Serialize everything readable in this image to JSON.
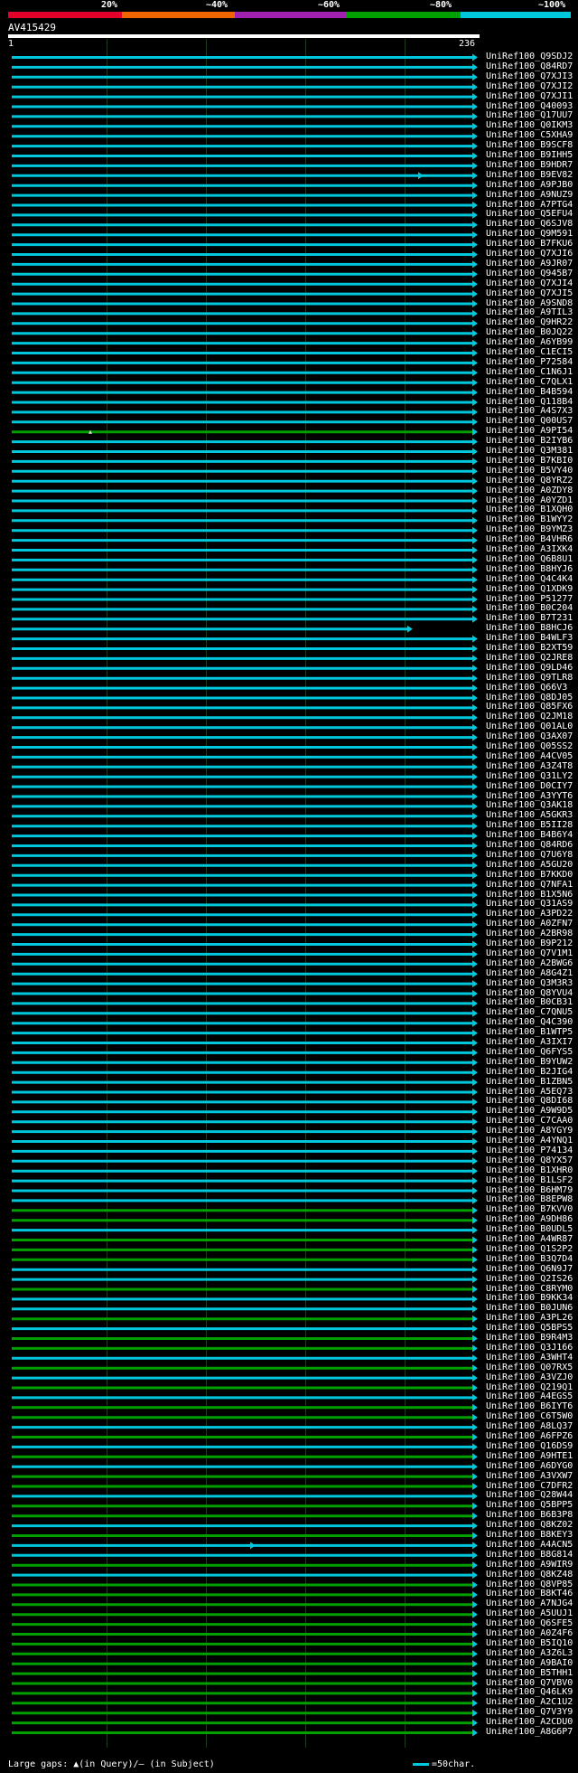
{
  "header": {
    "percent_labels": [
      "20%",
      "~40%",
      "~60%",
      "~80%",
      "~100%"
    ],
    "band_colors": [
      "#e0002a",
      "#f06400",
      "#a020b0",
      "#00a000",
      "#00c8dc"
    ],
    "query_id": "AV415429",
    "start": "1",
    "end": "236"
  },
  "colors": {
    "cyan": "#00c8dc",
    "green": "#00a000",
    "marker": "#dddddd",
    "gap": "#222222"
  },
  "hits": [
    "UniRef100_Q9SDJ2",
    "UniRef100_Q84RD7",
    "UniRef100_Q7XJI3",
    "UniRef100_Q7XJI2",
    "UniRef100_Q7XJI1",
    "UniRef100_Q40093",
    "UniRef100_Q17UU7",
    "UniRef100_Q0IKM3",
    "UniRef100_C5XHA9",
    "UniRef100_B9SCF8",
    "UniRef100_B9IHH5",
    "UniRef100_B9HDR7",
    "UniRef100_B9EV82",
    "UniRef100_A9PJB0",
    "UniRef100_A9NUZ9",
    "UniRef100_A7PTG4",
    "UniRef100_Q5EFU4",
    "UniRef100_Q6SJV8",
    "UniRef100_Q9M591",
    "UniRef100_B7FKU6",
    "UniRef100_Q7XJI6",
    "UniRef100_A9JR07",
    "UniRef100_Q945B7",
    "UniRef100_Q7XJI4",
    "UniRef100_Q7XJI5",
    "UniRef100_A9SND8",
    "UniRef100_A9TIL3",
    "UniRef100_Q9HR22",
    "UniRef100_B0JQ22",
    "UniRef100_A6YB99",
    "UniRef100_C1ECI5",
    "UniRef100_P72584",
    "UniRef100_C1N6J1",
    "UniRef100_C7QLX1",
    "UniRef100_B4B594",
    "UniRef100_Q118B4",
    "UniRef100_A4S7X3",
    "UniRef100_Q00US7",
    "UniRef100_A9PI54",
    "UniRef100_B2IYB6",
    "UniRef100_Q3M381",
    "UniRef100_B7KBI0",
    "UniRef100_B5VY40",
    "UniRef100_Q8YRZ2",
    "UniRef100_A0ZDY8",
    "UniRef100_A0YZD1",
    "UniRef100_B1XQH0",
    "UniRef100_B1WYY2",
    "UniRef100_B9YMZ3",
    "UniRef100_B4VHR6",
    "UniRef100_A3IXK4",
    "UniRef100_Q6B8U1",
    "UniRef100_B8HYJ6",
    "UniRef100_Q4C4K4",
    "UniRef100_Q1XDK9",
    "UniRef100_P51277",
    "UniRef100_B0C204",
    "UniRef100_B7T231",
    "UniRef100_B8HCJ6",
    "UniRef100_B4WLF3",
    "UniRef100_B2XT59",
    "UniRef100_Q2JRE8",
    "UniRef100_Q9LD46",
    "UniRef100_Q9TLR8",
    "UniRef100_Q66V3",
    "UniRef100_Q8DJ05",
    "UniRef100_Q85FX6",
    "UniRef100_Q2JM18",
    "UniRef100_Q01AL0",
    "UniRef100_Q3AX07",
    "UniRef100_Q05SS2",
    "UniRef100_A4CV05",
    "UniRef100_A3Z4T8",
    "UniRef100_Q31LY2",
    "UniRef100_D0CIY7",
    "UniRef100_A3YYT6",
    "UniRef100_Q3AK18",
    "UniRef100_A5GKR3",
    "UniRef100_B5II28",
    "UniRef100_B4B6Y4",
    "UniRef100_Q84RD6",
    "UniRef100_Q7U6Y8",
    "UniRef100_A5GU20",
    "UniRef100_B7KKD0",
    "UniRef100_Q7NFA1",
    "UniRef100_B1X5N6",
    "UniRef100_Q31AS9",
    "UniRef100_A3PD22",
    "UniRef100_A0ZFN7",
    "UniRef100_A2BR98",
    "UniRef100_B9P212",
    "UniRef100_Q7V1M1",
    "UniRef100_A2BWG6",
    "UniRef100_A8G4Z1",
    "UniRef100_Q3M3R3",
    "UniRef100_Q8YVU4",
    "UniRef100_B0CB31",
    "UniRef100_C7QNU5",
    "UniRef100_Q4C390",
    "UniRef100_B1WTP5",
    "UniRef100_A3IXI7",
    "UniRef100_Q6FYS5",
    "UniRef100_B9YUW2",
    "UniRef100_B2JIG4",
    "UniRef100_B1ZBN5",
    "UniRef100_A5EQ73",
    "UniRef100_Q8DI68",
    "UniRef100_A9W9D5",
    "UniRef100_C7CAA0",
    "UniRef100_A8YGY9",
    "UniRef100_A4YNQ1",
    "UniRef100_P74134",
    "UniRef100_Q8YX57",
    "UniRef100_B1XHR0",
    "UniRef100_B1LSF2",
    "UniRef100_B6HM79",
    "UniRef100_B8EPW8",
    "UniRef100_B7KVV0",
    "UniRef100_A9DH86",
    "UniRef100_B0UDL5",
    "UniRef100_A4WR87",
    "UniRef100_Q1S2P2",
    "UniRef100_B3Q7D4",
    "UniRef100_Q6N9J7",
    "UniRef100_Q2IS26",
    "UniRef100_C8RYM0",
    "UniRef100_B9KK34",
    "UniRef100_B0JUN6",
    "UniRef100_A3PL26",
    "UniRef100_Q5BPS5",
    "UniRef100_B9R4M3",
    "UniRef100_Q3J166",
    "UniRef100_A3WHT4",
    "UniRef100_Q07RX5",
    "UniRef100_A3VZJ0",
    "UniRef100_Q219Q1",
    "UniRef100_A4EGS5",
    "UniRef100_B6IYT6",
    "UniRef100_C6T5W0",
    "UniRef100_A8LQ37",
    "UniRef100_A6FPZ6",
    "UniRef100_Q16DS9",
    "UniRef100_A9HTE1",
    "UniRef100_A6DYG0",
    "UniRef100_A3VXW7",
    "UniRef100_C7DFR2",
    "UniRef100_Q28W44",
    "UniRef100_Q5BPP5",
    "UniRef100_B6B3P8",
    "UniRef100_Q8KZ02",
    "UniRef100_B8KEY3",
    "UniRef100_A4ACN5",
    "UniRef100_B8G814",
    "UniRef100_A9WIR9",
    "UniRef100_Q8KZ48",
    "UniRef100_Q8VP85",
    "UniRef100_B8KT46",
    "UniRef100_A7NJG4",
    "UniRef100_A5UUJ1",
    "UniRef100_Q6SFE5",
    "UniRef100_A0Z4F6",
    "UniRef100_B5IQ10",
    "UniRef100_A3Z6L3",
    "UniRef100_A9BAI0",
    "UniRef100_B5THH1",
    "UniRef100_Q7VBV0",
    "UniRef100_Q46LK9",
    "UniRef100_A2C1U2",
    "UniRef100_Q7V3Y9",
    "UniRef100_A2CDU0",
    "UniRef100_A8G6P7"
  ],
  "hit_style": {
    "green_rows": [
      38,
      117,
      118,
      120,
      121,
      122,
      125,
      128,
      130,
      131,
      133,
      135,
      137,
      138,
      140,
      142,
      144,
      145,
      147,
      148,
      150,
      153,
      155,
      156,
      157,
      158,
      159,
      160,
      161,
      162,
      163,
      164,
      165,
      166,
      167,
      168,
      169,
      170,
      171,
      172,
      173,
      174,
      175,
      176,
      177,
      178,
      179,
      180,
      181,
      182,
      183
    ],
    "short_rows": {
      "58": 0.86,
      "178": 0.98,
      "184": 0.22
    },
    "split_rows": [
      12,
      151
    ],
    "up_markers": [
      38,
      178,
      179,
      180,
      181,
      182,
      183
    ]
  },
  "legend": {
    "gaps_text": "Large gaps: ▲(in Query)/– (in Subject)",
    "scale_text": "=50char."
  }
}
